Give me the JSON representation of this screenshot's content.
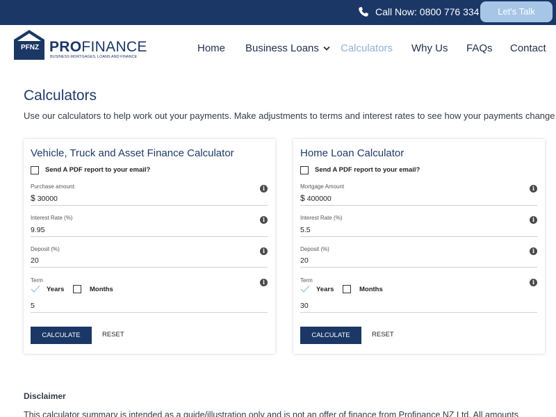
{
  "topbar": {
    "call_text": "Call Now: 0800 776 334",
    "talk_label": "Let's Talk",
    "bg_color": "#1b3766",
    "button_color": "#a6c6e8"
  },
  "logo": {
    "mark_text": "PFNZ",
    "name_bold": "PRO",
    "name_rest": "FINANCE",
    "tagline": "BUSINESS MORTGAGES, LOANS AND FINANCE"
  },
  "nav": {
    "items": [
      "Home",
      "Business Loans",
      "Calculators",
      "Why Us",
      "FAQs",
      "Contact"
    ],
    "active": "Calculators",
    "active_color": "#8fb2d8"
  },
  "page": {
    "title": "Calculators",
    "intro": "Use our calculators to help work out your payments. Make adjustments to terms and interest rates to see how your payments change."
  },
  "vehicle_calc": {
    "title": "Vehicle, Truck and Asset Finance Calculator",
    "pdf_label": "Send A PDF report to your email?",
    "amount_label": "Purchase amount:",
    "currency": "$",
    "amount_value": "30000",
    "rate_label": "Interest Rate (%)",
    "rate_value": "9.95",
    "deposit_label": "Deposit (%)",
    "deposit_value": "20",
    "term_label": "Term",
    "years_label": "Years",
    "months_label": "Months",
    "term_value": "5",
    "calculate_label": "CALCULATE",
    "reset_label": "RESET"
  },
  "home_calc": {
    "title": "Home Loan Calculator",
    "pdf_label": "Send A PDF report to your email?",
    "amount_label": "Mortgage Amount",
    "currency": "$",
    "amount_value": "400000",
    "rate_label": "Interest Rate (%)",
    "rate_value": "5.5",
    "deposit_label": "Deposit (%)",
    "deposit_value": "20",
    "term_label": "Term",
    "years_label": "Years",
    "months_label": "Months",
    "term_value": "30",
    "calculate_label": "CALCULATE",
    "reset_label": "RESET"
  },
  "disclaimer": {
    "title": "Disclaimer",
    "text": "This calculator summary is intended as a guide/illustration only and is not an offer of finance from Profinance NZ Ltd. All amounts"
  }
}
